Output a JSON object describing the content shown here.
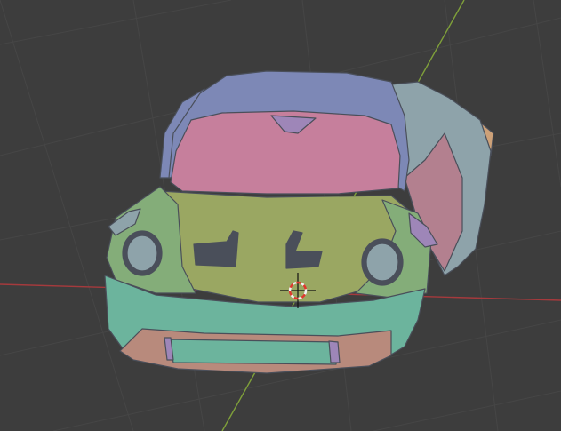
{
  "viewport": {
    "background": "#3d3d3d",
    "grid_color": "#464646",
    "x_axis_color": "#a53a3d",
    "y_axis_color": "#7fa03a"
  },
  "model": {
    "palette": {
      "roof": "#7d88b6",
      "windshield": "#c67f9c",
      "hood": "#9aa762",
      "bumper": "#6cb49d",
      "fender_left": "#84ad79",
      "fender_right": "#8ea3aa",
      "door_right": "#b3808f",
      "lip": "#b88a7c",
      "rear_panel": "#cda178",
      "trim": "#9e86b8",
      "outline": "#4a4f5a"
    }
  },
  "cursor": {
    "icon": "3d-cursor-icon",
    "ring_red": "#e0382e",
    "ring_white": "#f2f2f2",
    "crosshair": "#111111"
  }
}
